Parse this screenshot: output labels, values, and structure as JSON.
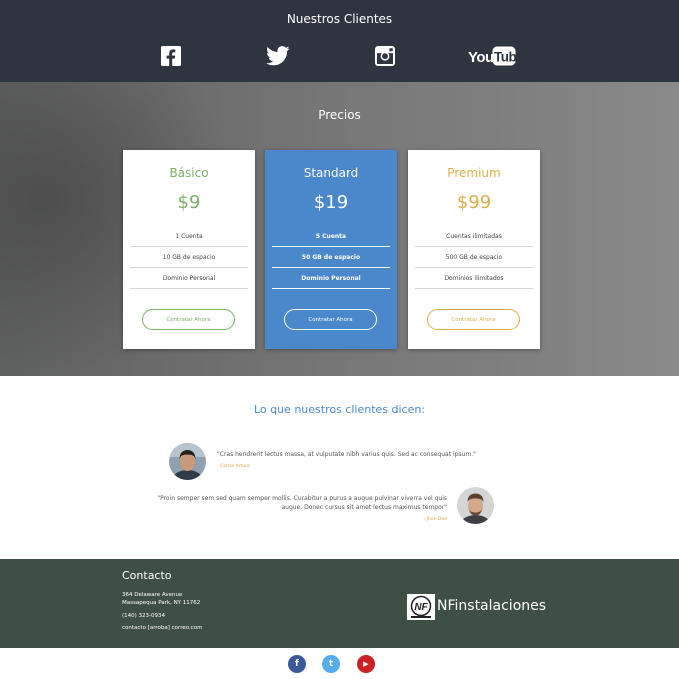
{
  "clients": {
    "title": "Nuestros Clientes",
    "brands": [
      "facebook-icon",
      "twitter-icon",
      "instagram-icon",
      "youtube-icon"
    ],
    "youtube_text": "YouTube"
  },
  "pricing": {
    "title": "Precios",
    "plans": [
      {
        "name": "Básico",
        "price": "$9",
        "features": [
          "1 Cuenta",
          "10 GB de espacio",
          "Dominio Personal"
        ],
        "cta": "Contratar Ahora",
        "color": "#7cb06b"
      },
      {
        "name": "Standard",
        "price": "$19",
        "features": [
          "5 Cuenta",
          "50 GB de espacio",
          "Dominio Personal"
        ],
        "cta": "Contratar Ahora",
        "color": "#4a88cb"
      },
      {
        "name": "Premium",
        "price": "$99",
        "features": [
          "Cuentas ilimitadas",
          "500 GB de espacio",
          "Dominios ilimitados"
        ],
        "cta": "Contratar Ahora",
        "color": "#d8b14b"
      }
    ]
  },
  "testimonials": {
    "title": "Lo que nuestros clientes dicen:",
    "items": [
      {
        "quote": "\"Cras hendrerit lectus massa, at vulputate nibh varius quis. Sed ac consequat ipsum.\"",
        "author": "- Carlos Arturo"
      },
      {
        "quote_line1": "\"Proin semper sem sed quam semper mollis. Curabitur a purus a augue pulvinar viverra vel quis",
        "quote_line2": "augue. Donec cursus sit amet lectus maximus tempor\"",
        "author": "- Jhon Doe"
      }
    ]
  },
  "footer": {
    "contact_title": "Contacto",
    "address_line1": "364 Delaware Avenue",
    "address_line2": "Massapequa Park, NY 11762",
    "phone": "(140) 323-0934",
    "email": "contacto [arroba] correo.com",
    "logo_text": "NFinstalaciones",
    "logo_mark": "NF"
  },
  "social": {
    "facebook": "f",
    "twitter": "t",
    "youtube": "▶",
    "colors": {
      "facebook": "#3b5998",
      "twitter": "#55acee",
      "youtube": "#cc2127"
    }
  },
  "colors": {
    "clients_bg": "#2e3540",
    "footer_bg": "#3e5046",
    "accent": "#4a88cb"
  }
}
